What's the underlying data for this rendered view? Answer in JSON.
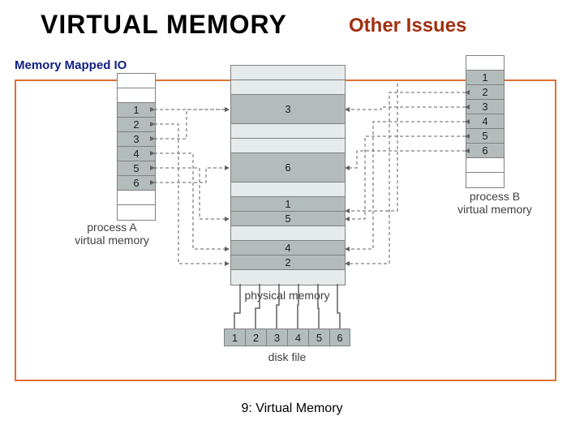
{
  "header": {
    "main_title": "VIRTUAL MEMORY",
    "sub_title": "Other Issues"
  },
  "section": {
    "label": "Memory Mapped IO"
  },
  "footer": {
    "text": "9: Virtual Memory"
  },
  "diagram": {
    "process_a": {
      "caption_line1": "process A",
      "caption_line2": "virtual memory",
      "rows": [
        "",
        "",
        "1",
        "2",
        "3",
        "4",
        "5",
        "6",
        "",
        ""
      ]
    },
    "process_b": {
      "caption_line1": "process B",
      "caption_line2": "virtual memory",
      "rows": [
        "",
        "1",
        "2",
        "3",
        "4",
        "5",
        "6",
        "",
        ""
      ]
    },
    "physical": {
      "caption": "physical memory",
      "rows": [
        "",
        "",
        "3",
        "",
        "",
        "6",
        "",
        "1",
        "5",
        "",
        "4",
        "2",
        ""
      ]
    },
    "disk": {
      "caption": "disk file",
      "cells": [
        "1",
        "2",
        "3",
        "4",
        "5",
        "6"
      ]
    }
  }
}
